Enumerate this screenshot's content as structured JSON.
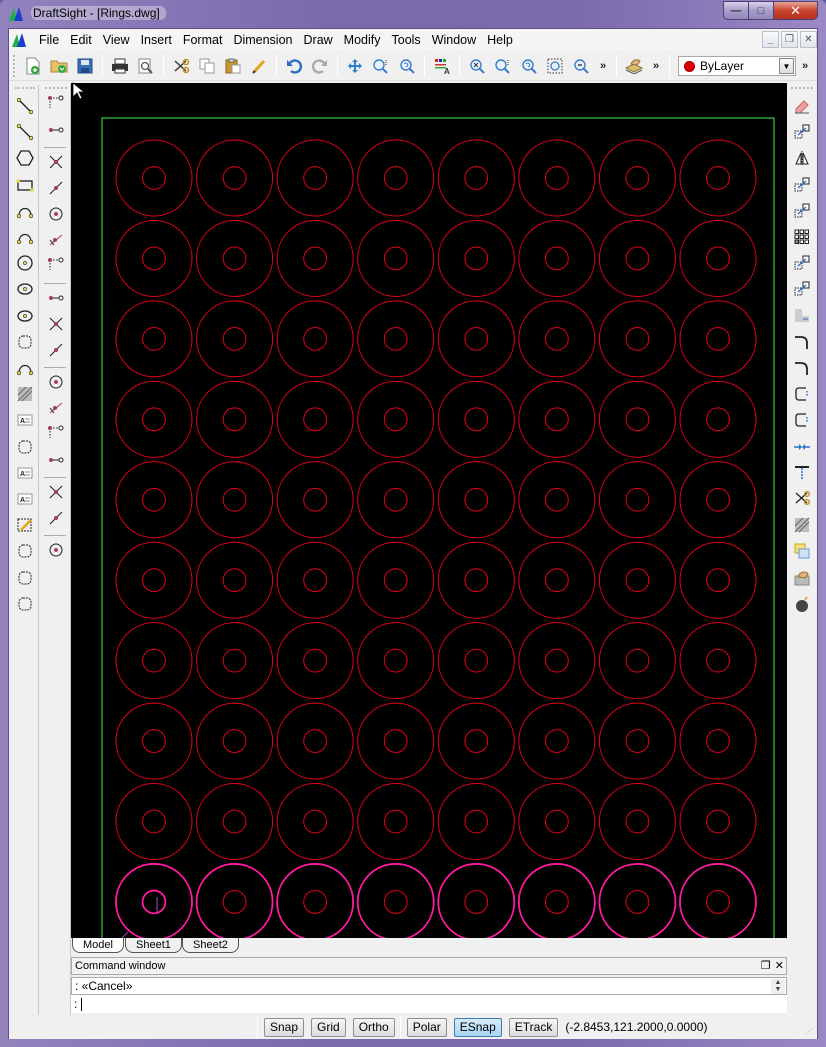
{
  "window": {
    "title": "DraftSight - [Rings.dwg]",
    "controls": {
      "minimize": "—",
      "maximize": "□",
      "close": "✕"
    }
  },
  "menubar": {
    "items": [
      "File",
      "Edit",
      "View",
      "Insert",
      "Format",
      "Dimension",
      "Draw",
      "Modify",
      "Tools",
      "Window",
      "Help"
    ],
    "mdi_controls": {
      "minimize": "_",
      "restore": "❐",
      "close": "✕"
    }
  },
  "toolbar": {
    "groups": [
      [
        "new-icon",
        "open-icon",
        "save-icon"
      ],
      [
        "print-icon",
        "print-preview-icon"
      ],
      [
        "cut-icon",
        "copy-icon",
        "paste-icon",
        "format-painter-icon"
      ],
      [
        "undo-icon",
        "redo-icon"
      ],
      [
        "pan-icon",
        "zoom-realtime-icon",
        "zoom-previous-icon"
      ],
      [
        "layer-manager-icon"
      ],
      [
        "zoom-window-icon",
        "zoom-in-icon",
        "zoom-dynamic-icon",
        "zoom-bounds-icon",
        "zoom-out-icon"
      ]
    ],
    "more_label": "»",
    "layer_tool_icon": "layer-state-icon",
    "layer_combo": {
      "value": "ByLayer",
      "color": "#e00000"
    }
  },
  "left_toolbar_draw": [
    "line-icon",
    "infinite-line-icon",
    "polygon-icon",
    "rectangle-icon",
    "arc-icon",
    "arc-3point-icon",
    "circle-icon",
    "ellipse-icon",
    "ellipse-arc-icon",
    "point-cloud-icon",
    "spline-icon",
    "hatch-icon",
    "insert-text-icon",
    "revision-cloud-icon",
    "note-icon",
    "simple-note-icon",
    "edit-block-icon",
    "rectangle-cloud-icon",
    "circle-cloud-icon",
    "freehand-cloud-icon"
  ],
  "left_toolbar_snap": [
    [
      "snap-endpoint-icon",
      "snap-midpoint-icon"
    ],
    [
      "snap-intersection-icon",
      "snap-apparent-intersection-icon",
      "snap-extension-icon",
      "snap-perpendicular-icon",
      "snap-nearest-icon"
    ],
    [
      "snap-center-icon",
      "snap-quadrant-icon",
      "snap-tangent-icon"
    ],
    [
      "snap-insertion-icon",
      "snap-node-icon",
      "snap-parallel-icon",
      "snap-perpendicular-2-icon"
    ],
    [
      "snap-nearest-2-icon",
      "snap-clear-icon"
    ],
    [
      "snap-settings-icon"
    ]
  ],
  "right_toolbar_modify": [
    "erase-icon",
    "copy-entity-icon",
    "mirror-icon",
    "move-icon",
    "offset-icon",
    "pattern-icon",
    "rotate-icon",
    "scale-icon",
    "stretch-icon",
    "fillet-icon",
    "chamfer-icon",
    "break-icon",
    "break-at-point-icon",
    "join-icon",
    "extend-icon",
    "trim-icon",
    "edit-hatch-icon",
    "order-icon",
    "edit-properties-icon",
    "explode-icon"
  ],
  "drawing": {
    "rows": 10,
    "cols": 8,
    "normal_color": "#e3001b",
    "selected_row_color": "#ff1aa0",
    "selected_row": 9,
    "border_color": "#3cc83c",
    "inner_ratio": 0.3
  },
  "sheet_tabs": [
    {
      "label": "Model",
      "active": true
    },
    {
      "label": "Sheet1",
      "active": false
    },
    {
      "label": "Sheet2",
      "active": false
    }
  ],
  "command_window": {
    "title": "Command window",
    "history": ": «Cancel»",
    "prompt": ":",
    "input_value": ""
  },
  "statusbar": {
    "toggles": [
      {
        "label": "Snap",
        "on": false
      },
      {
        "label": "Grid",
        "on": false
      },
      {
        "label": "Ortho",
        "on": false
      },
      {
        "label": "Polar",
        "on": false
      },
      {
        "label": "ESnap",
        "on": true
      },
      {
        "label": "ETrack",
        "on": false
      }
    ],
    "coordinates": "(-2.8453,121.2000,0.0000)"
  }
}
